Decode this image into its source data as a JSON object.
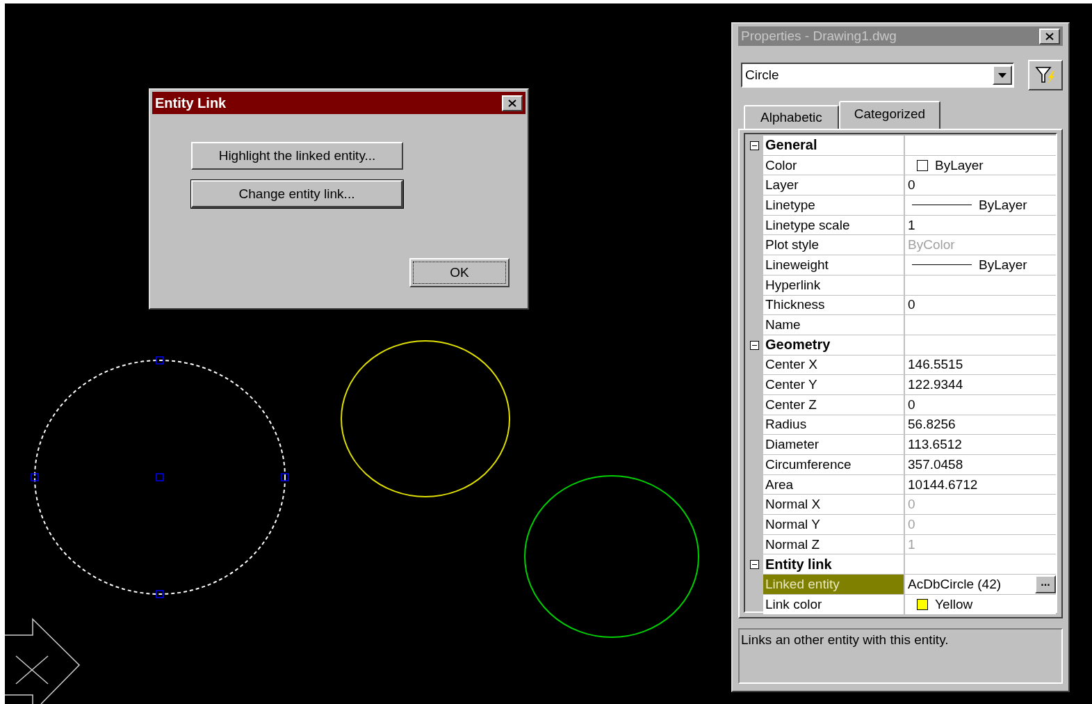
{
  "canvas": {
    "entities": [
      {
        "color": "#ffffff",
        "selected": true
      },
      {
        "color": "#e0e000",
        "selected": false
      },
      {
        "color": "#00d000",
        "selected": false
      }
    ]
  },
  "dialog": {
    "title": "Entity Link",
    "buttons": [
      {
        "label": "Highlight the linked entity...",
        "default": false
      },
      {
        "label": "Change entity link...",
        "default": true
      }
    ],
    "ok": {
      "label": "OK",
      "focused": true
    }
  },
  "properties": {
    "title": "Properties - Drawing1.dwg",
    "object_type": "Circle",
    "tabs": [
      {
        "label": "Alphabetic",
        "selected": false
      },
      {
        "label": "Categorized",
        "selected": true
      }
    ],
    "categories": [
      {
        "name": "General",
        "expanded": true,
        "rows": [
          {
            "name": "Color",
            "kind": "color",
            "value": "ByLayer",
            "color": "#ffffff",
            "disabled": false,
            "selected": false
          },
          {
            "name": "Layer",
            "kind": "text",
            "value": "0",
            "disabled": false,
            "selected": false
          },
          {
            "name": "Linetype",
            "kind": "linetype",
            "value": "ByLayer",
            "disabled": false,
            "selected": false
          },
          {
            "name": "Linetype scale",
            "kind": "text",
            "value": "1",
            "disabled": false,
            "selected": false
          },
          {
            "name": "Plot style",
            "kind": "text",
            "value": "ByColor",
            "disabled": true,
            "selected": false
          },
          {
            "name": "Lineweight",
            "kind": "linetype",
            "value": "ByLayer",
            "disabled": false,
            "selected": false
          },
          {
            "name": "Hyperlink",
            "kind": "text",
            "selected": false
          },
          {
            "name": "Thickness",
            "kind": "text",
            "value": "0",
            "disabled": false,
            "selected": false
          },
          {
            "name": "Name",
            "kind": "text",
            "selected": false
          }
        ]
      },
      {
        "name": "Geometry",
        "expanded": true,
        "rows": [
          {
            "name": "Center X",
            "kind": "text",
            "value": "146.5515",
            "disabled": false,
            "selected": false
          },
          {
            "name": "Center Y",
            "kind": "text",
            "value": "122.9344",
            "disabled": false,
            "selected": false
          },
          {
            "name": "Center Z",
            "kind": "text",
            "value": "0",
            "disabled": false,
            "selected": false
          },
          {
            "name": "Radius",
            "kind": "text",
            "value": "56.8256",
            "disabled": false,
            "selected": false
          },
          {
            "name": "Diameter",
            "kind": "text",
            "value": "113.6512",
            "disabled": false,
            "selected": false
          },
          {
            "name": "Circumference",
            "kind": "text",
            "value": "357.0458",
            "disabled": false,
            "selected": false
          },
          {
            "name": "Area",
            "kind": "text",
            "value": "10144.6712",
            "disabled": false,
            "selected": false
          },
          {
            "name": "Normal X",
            "kind": "text",
            "value": "0",
            "disabled": true,
            "selected": false
          },
          {
            "name": "Normal Y",
            "kind": "text",
            "value": "0",
            "disabled": true,
            "selected": false
          },
          {
            "name": "Normal Z",
            "kind": "text",
            "value": "1",
            "disabled": true,
            "selected": false
          }
        ]
      },
      {
        "name": "Entity link",
        "expanded": true,
        "rows": [
          {
            "name": "Linked entity",
            "kind": "button",
            "value": "AcDbCircle (42)",
            "button": "...",
            "disabled": false,
            "selected": true
          },
          {
            "name": "Link color",
            "kind": "color",
            "value": "Yellow",
            "color": "#ffff00",
            "disabled": false,
            "selected": false
          }
        ]
      }
    ],
    "description": "Links an other entity with this entity."
  }
}
